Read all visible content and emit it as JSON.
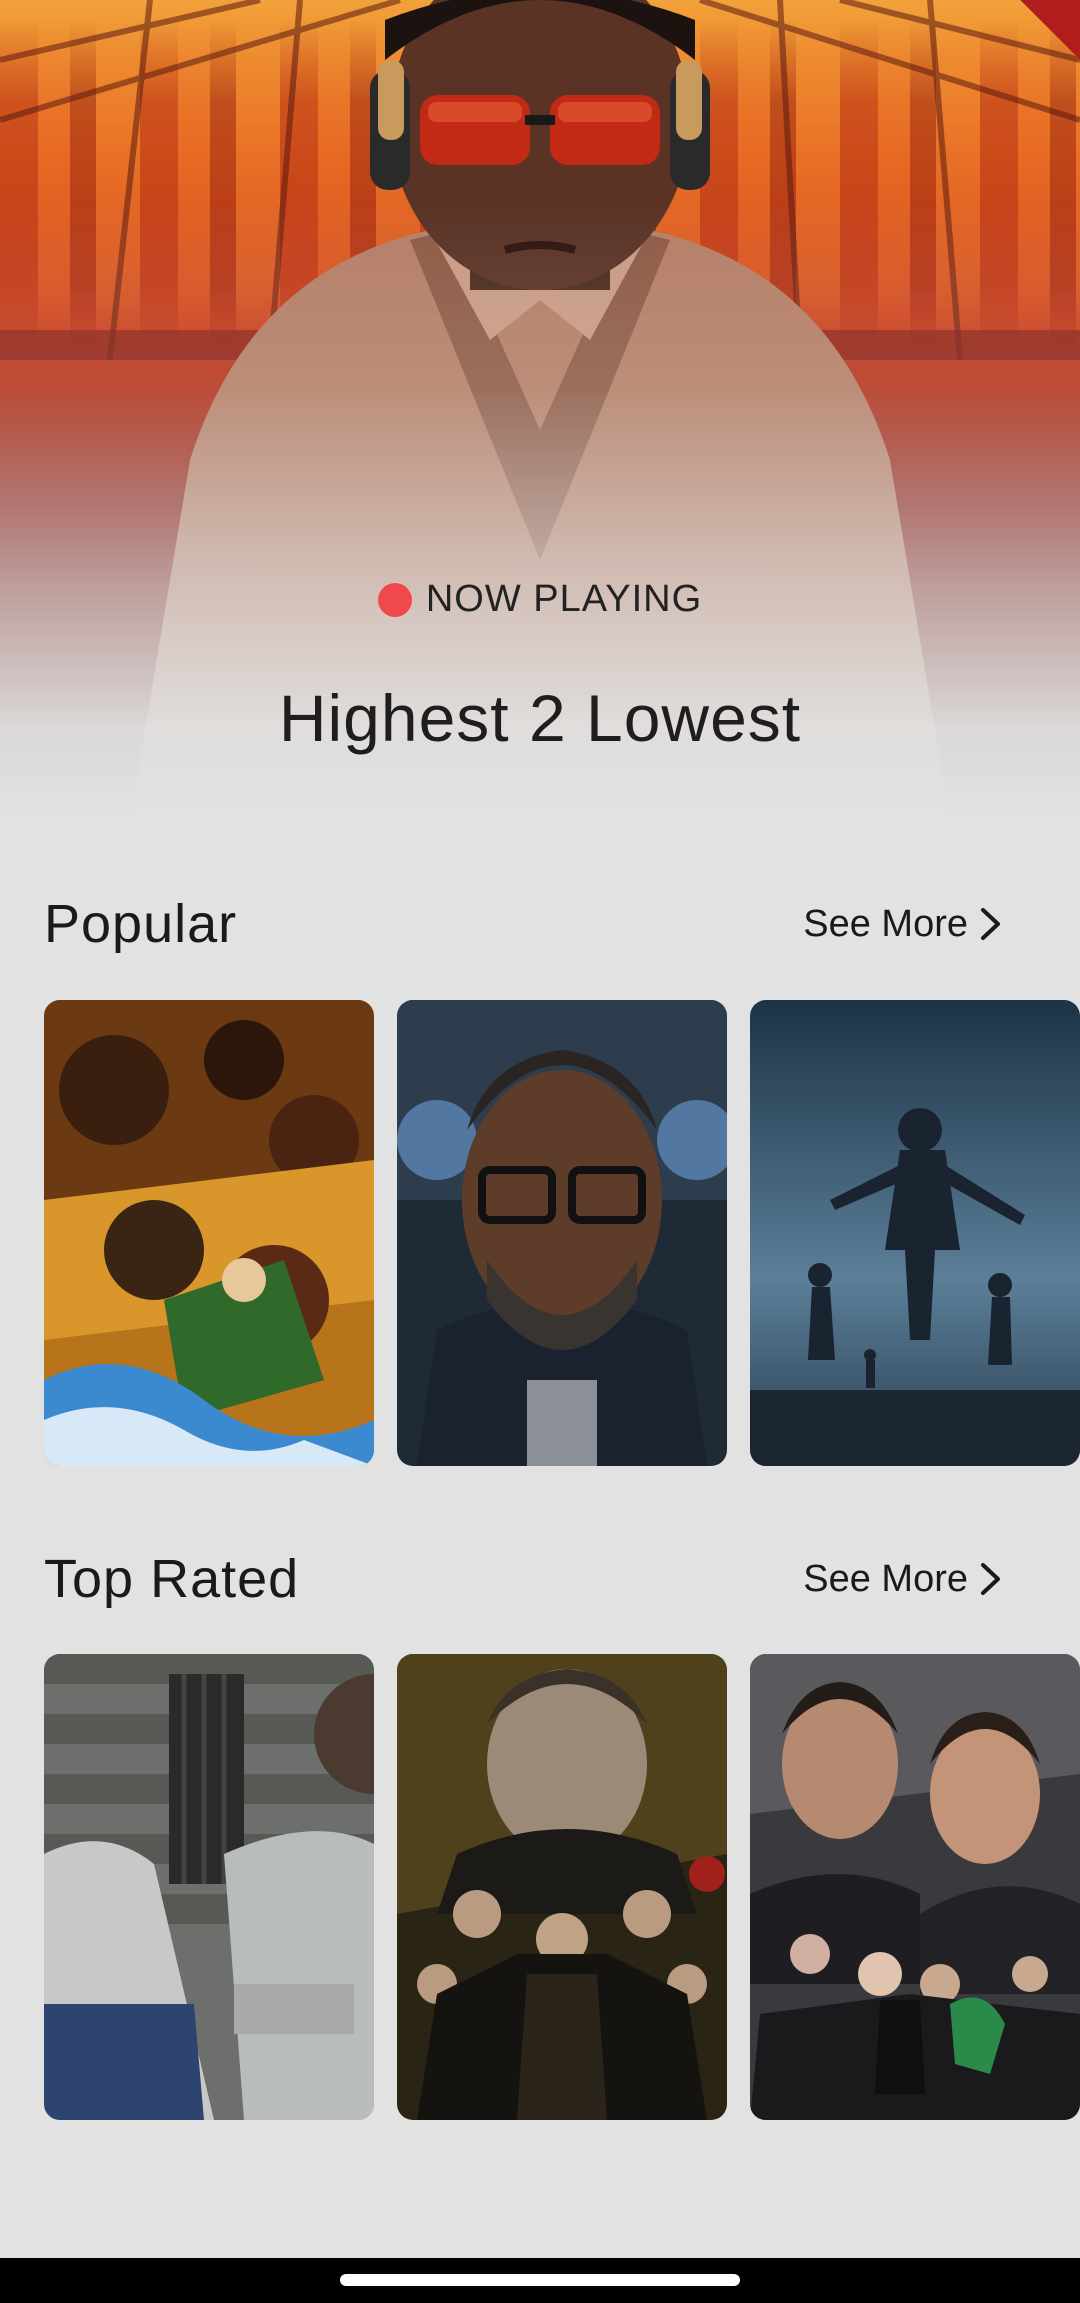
{
  "hero": {
    "badge_label": "NOW PLAYING",
    "title": "Highest 2 Lowest",
    "badge_color": "#f0494b"
  },
  "sections": [
    {
      "title": "Popular",
      "see_more_label": "See More",
      "items": [
        {
          "poster": "anime-action-poster"
        },
        {
          "poster": "man-with-glasses-poster"
        },
        {
          "poster": "silhouette-children-poster"
        }
      ]
    },
    {
      "title": "Top Rated",
      "see_more_label": "See More",
      "items": [
        {
          "poster": "prison-yard-poster"
        },
        {
          "poster": "mob-family-poster"
        },
        {
          "poster": "mob-family-sequel-poster"
        }
      ]
    }
  ],
  "colors": {
    "background": "#e2e2e2",
    "text": "#1a1a1a",
    "accent": "#f0494b"
  }
}
